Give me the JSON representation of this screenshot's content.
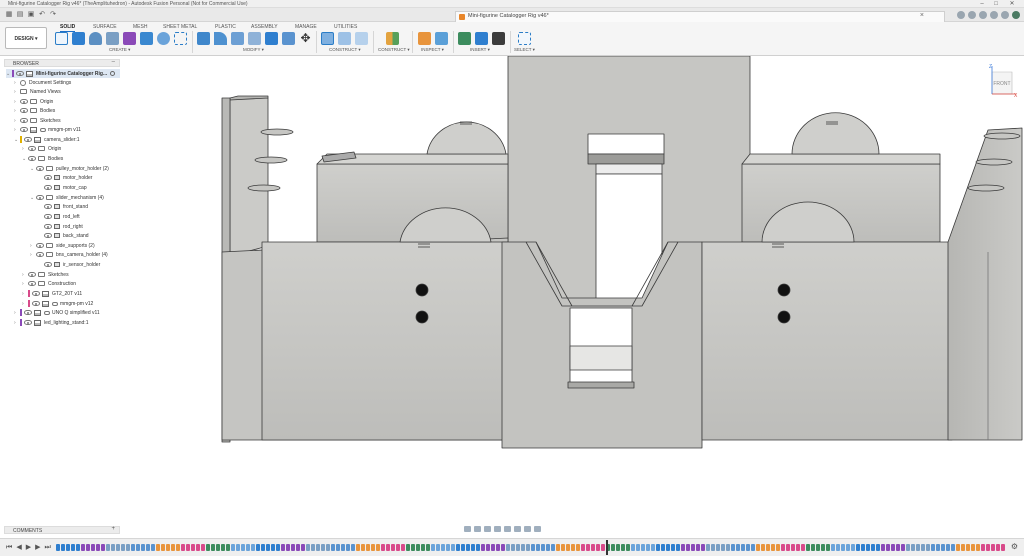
{
  "window": {
    "title": "Mini-figurine Catalogger Rig v46* (TheAmplituhedron) - Autodesk Fusion Personal (Not for Commercial Use)"
  },
  "doc_tab": {
    "title": "Mini-figurine Catalogger Rig v46*"
  },
  "workspace": {
    "label": "DESIGN ▾"
  },
  "ribbon": {
    "tabs": [
      "SOLID",
      "SURFACE",
      "MESH",
      "SHEET METAL",
      "PLASTIC",
      "ASSEMBLY",
      "MANAGE",
      "UTILITIES"
    ],
    "active_tab": "SOLID",
    "groups": [
      "CREATE ▾",
      "MODIFY ▾",
      "CONSTRUCT ▾",
      "INSPECT ▾",
      "INSERT ▾",
      "SELECT ▾"
    ]
  },
  "browser": {
    "header": "BROWSER",
    "items": [
      {
        "label": "Mini-figurine Catalogger Rig...",
        "type": "root"
      },
      {
        "label": "Document Settings",
        "type": "settings"
      },
      {
        "label": "Named Views",
        "type": "folder"
      },
      {
        "label": "Origin",
        "type": "folder"
      },
      {
        "label": "Bodies",
        "type": "folder"
      },
      {
        "label": "Sketches",
        "type": "folder"
      },
      {
        "label": "mmgm-pm v11",
        "type": "component"
      },
      {
        "label": "camera_slider:1",
        "type": "component"
      },
      {
        "label": "Origin",
        "type": "folder"
      },
      {
        "label": "Bodies",
        "type": "folder"
      },
      {
        "label": "pulley_motor_holder (2)",
        "type": "folder"
      },
      {
        "label": "motor_holder",
        "type": "body"
      },
      {
        "label": "motor_cap",
        "type": "body"
      },
      {
        "label": "slider_mechanism (4)",
        "type": "folder"
      },
      {
        "label": "front_stand",
        "type": "body"
      },
      {
        "label": "rod_left",
        "type": "body"
      },
      {
        "label": "rod_right",
        "type": "body"
      },
      {
        "label": "back_stand",
        "type": "body"
      },
      {
        "label": "side_supports (2)",
        "type": "folder"
      },
      {
        "label": "bns_camera_holder (4)",
        "type": "folder"
      },
      {
        "label": "ir_sensor_holder",
        "type": "body"
      },
      {
        "label": "Sketches",
        "type": "folder"
      },
      {
        "label": "Construction",
        "type": "folder"
      },
      {
        "label": "GT2_20T v11",
        "type": "component"
      },
      {
        "label": "mmgm-pm v12",
        "type": "component"
      },
      {
        "label": "UNO Q simplified v11",
        "type": "component"
      },
      {
        "label": "led_lighting_stand:1",
        "type": "component"
      }
    ]
  },
  "viewcube": {
    "face": "FRONT",
    "axis_z": "Z",
    "axis_x": "X"
  },
  "comments": {
    "label": "COMMENTS",
    "add": "+"
  },
  "colors": {
    "accent": "#1c6fc9",
    "model_fill": "#c9c9c6",
    "model_face": "#bdbdba",
    "model_edge": "#3a3a3a"
  }
}
